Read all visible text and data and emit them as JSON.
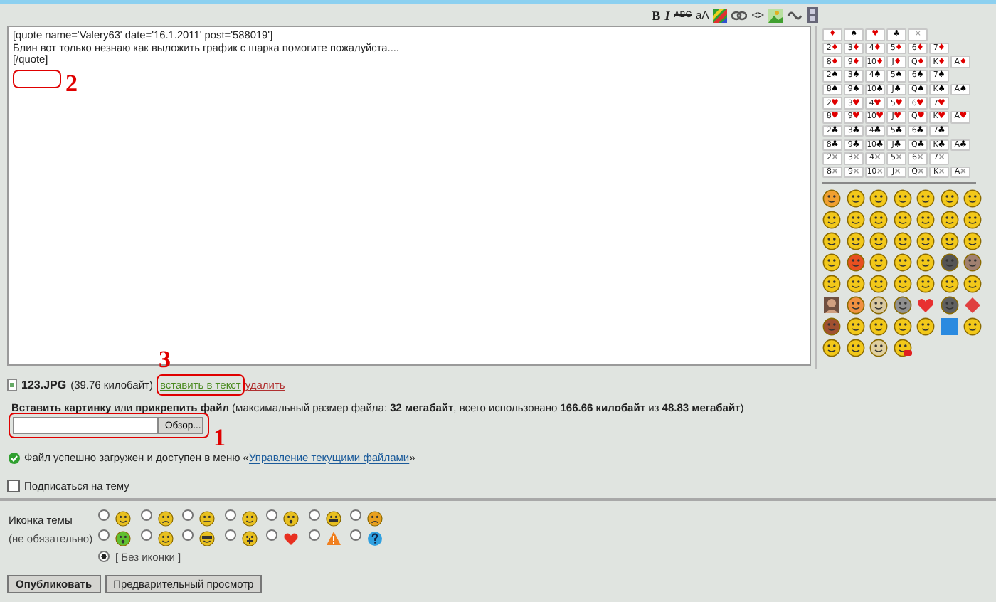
{
  "toolbar": [
    {
      "kind": "bold",
      "label": "B"
    },
    {
      "kind": "italic",
      "label": "I"
    },
    {
      "kind": "strike",
      "label": "ABC"
    },
    {
      "kind": "plain",
      "label": "aA"
    },
    {
      "kind": "color"
    },
    {
      "kind": "link"
    },
    {
      "kind": "plain",
      "label": "<>"
    },
    {
      "kind": "image"
    },
    {
      "kind": "wave"
    },
    {
      "kind": "film"
    }
  ],
  "message_lines": [
    "[quote name='Valery63' date='16.1.2011' post='588019']",
    "Блин вот только незнаю как выложить график с шарка помогите пожалуйста....",
    "[/quote]"
  ],
  "cards": {
    "suits": [
      {
        "symbol": "♦",
        "color": "#e00000"
      },
      {
        "symbol": "♠",
        "color": "#000000"
      },
      {
        "symbol": "♥",
        "color": "#e00000"
      },
      {
        "symbol": "♣",
        "color": "#000000"
      },
      {
        "symbol": "×",
        "color": "#999999"
      }
    ],
    "rows": [
      [
        {
          "rank": "2",
          "suit": "♦",
          "color": "#e00000"
        },
        {
          "rank": "3",
          "suit": "♦",
          "color": "#e00000"
        },
        {
          "rank": "4",
          "suit": "♦",
          "color": "#e00000"
        },
        {
          "rank": "5",
          "suit": "♦",
          "color": "#e00000"
        },
        {
          "rank": "6",
          "suit": "♦",
          "color": "#e00000"
        },
        {
          "rank": "7",
          "suit": "♦",
          "color": "#e00000"
        }
      ],
      [
        {
          "rank": "8",
          "suit": "♦",
          "color": "#e00000"
        },
        {
          "rank": "9",
          "suit": "♦",
          "color": "#e00000"
        },
        {
          "rank": "10",
          "suit": "♦",
          "color": "#e00000"
        },
        {
          "rank": "J",
          "suit": "♦",
          "color": "#e00000"
        },
        {
          "rank": "Q",
          "suit": "♦",
          "color": "#e00000"
        },
        {
          "rank": "K",
          "suit": "♦",
          "color": "#e00000"
        },
        {
          "rank": "A",
          "suit": "♦",
          "color": "#e00000"
        }
      ],
      [
        {
          "rank": "2",
          "suit": "♠",
          "color": "#000000"
        },
        {
          "rank": "3",
          "suit": "♠",
          "color": "#000000"
        },
        {
          "rank": "4",
          "suit": "♠",
          "color": "#000000"
        },
        {
          "rank": "5",
          "suit": "♠",
          "color": "#000000"
        },
        {
          "rank": "6",
          "suit": "♠",
          "color": "#000000"
        },
        {
          "rank": "7",
          "suit": "♠",
          "color": "#000000"
        }
      ],
      [
        {
          "rank": "8",
          "suit": "♠",
          "color": "#000000"
        },
        {
          "rank": "9",
          "suit": "♠",
          "color": "#000000"
        },
        {
          "rank": "10",
          "suit": "♠",
          "color": "#000000"
        },
        {
          "rank": "J",
          "suit": "♠",
          "color": "#000000"
        },
        {
          "rank": "Q",
          "suit": "♠",
          "color": "#000000"
        },
        {
          "rank": "K",
          "suit": "♠",
          "color": "#000000"
        },
        {
          "rank": "A",
          "suit": "♠",
          "color": "#000000"
        }
      ],
      [
        {
          "rank": "2",
          "suit": "♥",
          "color": "#e00000"
        },
        {
          "rank": "3",
          "suit": "♥",
          "color": "#e00000"
        },
        {
          "rank": "4",
          "suit": "♥",
          "color": "#e00000"
        },
        {
          "rank": "5",
          "suit": "♥",
          "color": "#e00000"
        },
        {
          "rank": "6",
          "suit": "♥",
          "color": "#e00000"
        },
        {
          "rank": "7",
          "suit": "♥",
          "color": "#e00000"
        }
      ],
      [
        {
          "rank": "8",
          "suit": "♥",
          "color": "#e00000"
        },
        {
          "rank": "9",
          "suit": "♥",
          "color": "#e00000"
        },
        {
          "rank": "10",
          "suit": "♥",
          "color": "#e00000"
        },
        {
          "rank": "J",
          "suit": "♥",
          "color": "#e00000"
        },
        {
          "rank": "Q",
          "suit": "♥",
          "color": "#e00000"
        },
        {
          "rank": "K",
          "suit": "♥",
          "color": "#e00000"
        },
        {
          "rank": "A",
          "suit": "♥",
          "color": "#e00000"
        }
      ],
      [
        {
          "rank": "2",
          "suit": "♣",
          "color": "#000000"
        },
        {
          "rank": "3",
          "suit": "♣",
          "color": "#000000"
        },
        {
          "rank": "4",
          "suit": "♣",
          "color": "#000000"
        },
        {
          "rank": "5",
          "suit": "♣",
          "color": "#000000"
        },
        {
          "rank": "6",
          "suit": "♣",
          "color": "#000000"
        },
        {
          "rank": "7",
          "suit": "♣",
          "color": "#000000"
        }
      ],
      [
        {
          "rank": "8",
          "suit": "♣",
          "color": "#000000"
        },
        {
          "rank": "9",
          "suit": "♣",
          "color": "#000000"
        },
        {
          "rank": "10",
          "suit": "♣",
          "color": "#000000"
        },
        {
          "rank": "J",
          "suit": "♣",
          "color": "#000000"
        },
        {
          "rank": "Q",
          "suit": "♣",
          "color": "#000000"
        },
        {
          "rank": "K",
          "suit": "♣",
          "color": "#000000"
        },
        {
          "rank": "A",
          "suit": "♣",
          "color": "#000000"
        }
      ],
      [
        {
          "rank": "2",
          "suit": "×",
          "color": "#999999"
        },
        {
          "rank": "3",
          "suit": "×",
          "color": "#999999"
        },
        {
          "rank": "4",
          "suit": "×",
          "color": "#999999"
        },
        {
          "rank": "5",
          "suit": "×",
          "color": "#999999"
        },
        {
          "rank": "6",
          "suit": "×",
          "color": "#999999"
        },
        {
          "rank": "7",
          "suit": "×",
          "color": "#999999"
        }
      ],
      [
        {
          "rank": "8",
          "suit": "×",
          "color": "#999999"
        },
        {
          "rank": "9",
          "suit": "×",
          "color": "#999999"
        },
        {
          "rank": "10",
          "suit": "×",
          "color": "#999999"
        },
        {
          "rank": "J",
          "suit": "×",
          "color": "#999999"
        },
        {
          "rank": "Q",
          "suit": "×",
          "color": "#999999"
        },
        {
          "rank": "K",
          "suit": "×",
          "color": "#999999"
        },
        {
          "rank": "A",
          "suit": "×",
          "color": "#999999"
        }
      ]
    ]
  },
  "attachment": {
    "file_name": "123.JPG",
    "size": "(39.76 килобайт)",
    "insert_link": "вставить в текст",
    "delete_link": "удалить"
  },
  "upload": {
    "text": "**Вставить картинку** или **прикрепить файл** (максимальный размер файла: **32 мегабайт**, всего использовано **166.66 килобайт** из **48.83 мегабайт**)",
    "browse_button": "Обзор..."
  },
  "notice": {
    "before": "Файл успешно загружен и доступен в меню «",
    "link": "Управление текущими файлами",
    "after": "»"
  },
  "subscribe": {
    "label": "Подписаться на тему",
    "checked": false
  },
  "topic_icon": {
    "label": "Иконка темы",
    "hint": "(не обязательно)",
    "options": [
      {
        "selected": false
      },
      {
        "selected": false
      },
      {
        "selected": false
      },
      {
        "selected": false
      },
      {
        "selected": false
      },
      {
        "selected": false
      },
      {
        "selected": false
      },
      {
        "selected": false
      },
      {
        "selected": false
      },
      {
        "selected": false
      },
      {
        "selected": false
      },
      {
        "selected": false
      },
      {
        "selected": false
      },
      {
        "selected": false
      }
    ],
    "none_option": {
      "label": "[ Без иконки ]",
      "selected": true
    }
  },
  "buttons": [
    "Опубликовать",
    "Предварительный просмотр"
  ],
  "annotations": [
    {
      "label": "2"
    },
    {
      "label": "3"
    },
    {
      "label": "1"
    }
  ]
}
